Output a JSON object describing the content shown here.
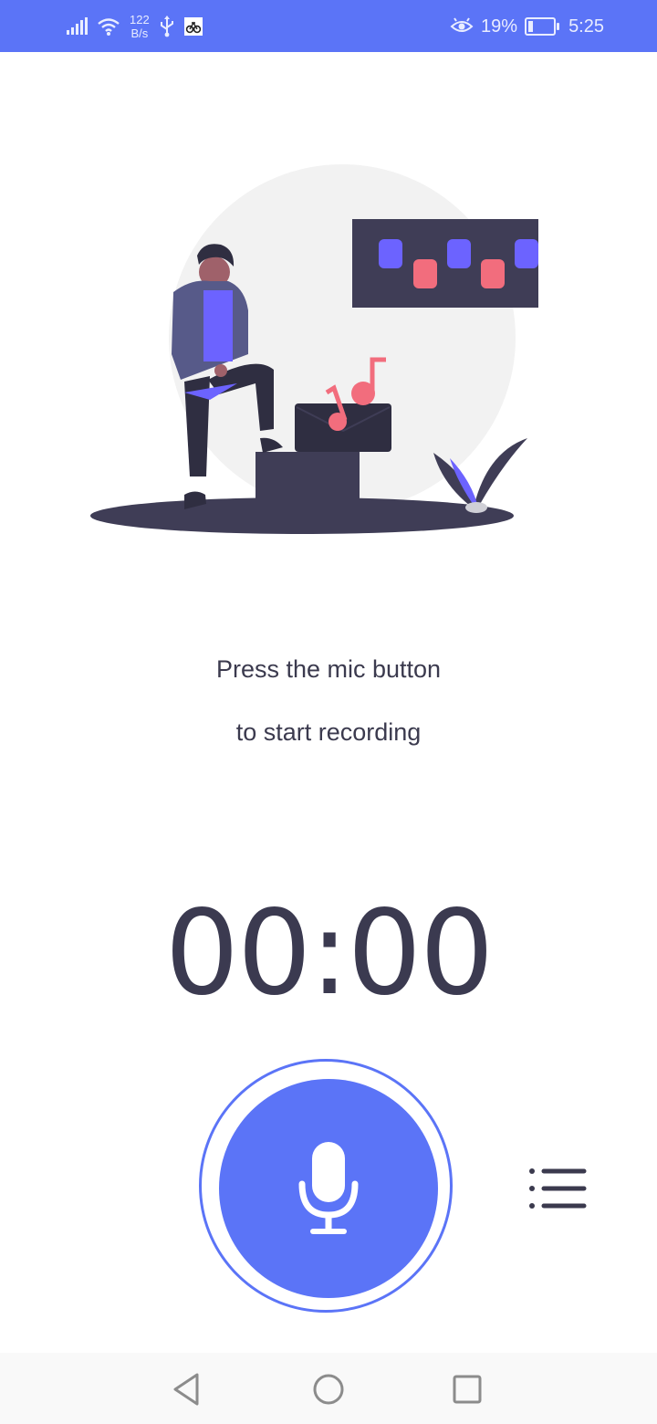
{
  "status_bar": {
    "network_speed_value": "122",
    "network_speed_unit": "B/s",
    "battery_percent": "19%",
    "time": "5:25",
    "battery_level": 0.19,
    "icons": [
      "signal-icon",
      "wifi-icon",
      "usb-icon",
      "notification-icon",
      "eye-comfort-icon",
      "battery-icon"
    ]
  },
  "main": {
    "prompt_line1": "Press the mic button",
    "prompt_line2": "to start recording",
    "timer": "00:00"
  },
  "controls": {
    "mic_icon": "microphone-icon",
    "list_icon": "list-icon"
  },
  "nav_bar": {
    "icons": [
      "back-icon",
      "home-icon",
      "recents-icon"
    ]
  },
  "colors": {
    "accent": "#5b74f7",
    "text_dark": "#3b3a4e",
    "illustration_purple": "#6c63ff",
    "illustration_pink": "#f26d7d",
    "illustration_dark": "#3f3d56"
  }
}
